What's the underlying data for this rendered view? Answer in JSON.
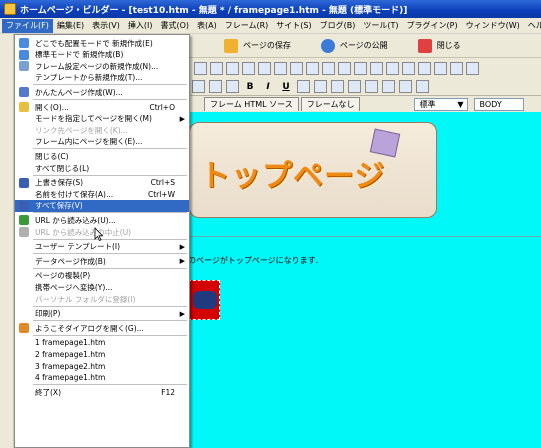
{
  "window": {
    "title": "ホームページ・ビルダー - [test10.htm - 無題 * / framepage1.htm - 無題 (標準モード)]"
  },
  "menubar": [
    "ファイル(F)",
    "編集(E)",
    "表示(V)",
    "挿入(I)",
    "書式(O)",
    "表(A)",
    "フレーム(R)",
    "サイト(S)",
    "ブログ(B)",
    "ツール(T)",
    "プラグイン(P)",
    "ウィンドウ(W)",
    "ヘルプ(H)"
  ],
  "toolbar": {
    "save_page": "ページの保存",
    "publish_page": "ページの公開",
    "close": "閉じる"
  },
  "tabs": [
    "フレーム HTML ソース",
    "フレームなし"
  ],
  "style_combo": "標準",
  "body_combo": "BODY",
  "banner_text": "トップページ",
  "body_text": "のページがトップページになります.",
  "file_menu": [
    {
      "label": "どこでも配置モードで 新規作成(E)",
      "icon": "new-freelayout-icon"
    },
    {
      "label": "標準モードで 新規作成(B)",
      "icon": "new-standard-icon"
    },
    {
      "label": "フレーム設定ページの新規作成(N)...",
      "icon": "new-frame-icon"
    },
    {
      "label": "テンプレートから新規作成(T)..."
    },
    {
      "sep": true
    },
    {
      "label": "かんたんページ作成(W)...",
      "icon": "easy-page-icon"
    },
    {
      "sep": true
    },
    {
      "label": "開く(O)...",
      "shortcut": "Ctrl+O",
      "icon": "open-folder-icon"
    },
    {
      "label": "モードを指定してページを開く(M)",
      "arrow": true
    },
    {
      "label": "リンク先ページを開く(K)...",
      "disabled": true
    },
    {
      "label": "フレーム内にページを開く(E)..."
    },
    {
      "sep": true
    },
    {
      "label": "閉じる(C)"
    },
    {
      "label": "すべて閉じる(L)"
    },
    {
      "sep": true
    },
    {
      "label": "上書き保存(S)",
      "shortcut": "Ctrl+S",
      "icon": "save-icon"
    },
    {
      "label": "名前を付けて保存(A)...",
      "shortcut": "Ctrl+W"
    },
    {
      "label": "すべて保存(V)",
      "highlight": true,
      "icon": "save-all-icon"
    },
    {
      "sep": true
    },
    {
      "label": "URL から読み込み(U)...",
      "icon": "url-load-icon"
    },
    {
      "label": "URL から読み込みの中止(U)",
      "disabled": true,
      "icon": "url-stop-icon"
    },
    {
      "sep": true
    },
    {
      "label": "ユーザー テンプレート(I)",
      "arrow": true
    },
    {
      "sep": true
    },
    {
      "label": "データページ作成(B)",
      "arrow": true
    },
    {
      "sep": true
    },
    {
      "label": "ページの複製(P)"
    },
    {
      "label": "携帯ページへ変換(Y)..."
    },
    {
      "label": "パーソナル フォルダに登録(I)",
      "disabled": true
    },
    {
      "sep": true
    },
    {
      "label": "印刷(P)",
      "arrow": true
    },
    {
      "sep": true
    },
    {
      "label": "ようこそダイアログを開く(G)...",
      "icon": "welcome-icon"
    },
    {
      "sep": true
    },
    {
      "label": "1 framepage1.htm"
    },
    {
      "label": "2 framepage1.htm"
    },
    {
      "label": "3 framepage2.htm"
    },
    {
      "label": "4 framepage1.htm"
    },
    {
      "sep": true
    },
    {
      "label": "終了(X)",
      "shortcut": "F12"
    }
  ],
  "colors": {
    "canvas": "#00f8f8",
    "highlight": "#316ac5",
    "titlebar": "#0b3fb8"
  }
}
